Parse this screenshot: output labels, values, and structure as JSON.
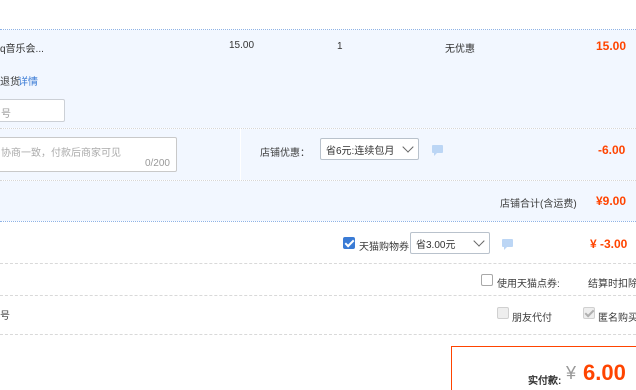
{
  "item": {
    "title": "q音乐会...",
    "unit_price": "15.00",
    "quantity": "1",
    "discount": "无优惠",
    "subtotal": "15.00",
    "service_note": "退货",
    "detail_link": "详情"
  },
  "contact": {
    "partial_label": "号"
  },
  "message": {
    "placeholder": "协商一致，付款后商家可见",
    "char_count": "0/200"
  },
  "shop_promo": {
    "label": "店铺优惠：",
    "selected": "省6元:连续包月",
    "amount": "-6.00"
  },
  "shop_total": {
    "label": "店铺合计(含运费)",
    "amount": "¥9.00"
  },
  "coupon": {
    "label": "天猫购物券",
    "checked": true,
    "selected": "省3.00元",
    "amount": "¥ -3.00"
  },
  "points": {
    "label": "使用天猫点券:",
    "note": "结算时扣除"
  },
  "partial_row": {
    "label": "号"
  },
  "options": {
    "friend_pay": "朋友代付",
    "anonymous": "匿名购买"
  },
  "payment": {
    "label": "实付款:",
    "currency": "¥",
    "amount": "6.00"
  },
  "colors": {
    "accent": "#ff4400",
    "brand_blue": "#3a7bd5",
    "band": "#f2f7ff"
  },
  "icons": {
    "message": "chat-bubble-icon",
    "dropdown": "chevron-down-icon"
  }
}
